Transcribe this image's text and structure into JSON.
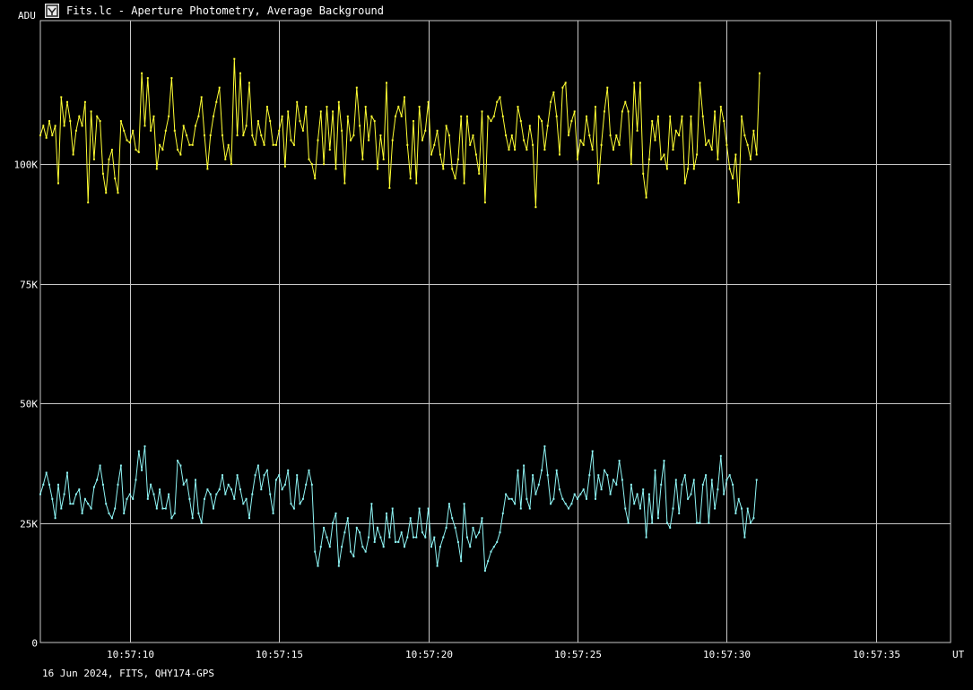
{
  "window": {
    "title": "Fits.lc - Aperture Photometry, Average Background",
    "icon": "app-icon"
  },
  "footer": "16 Jun 2024, FITS, QHY174-GPS",
  "colors": {
    "background": "#000000",
    "grid": "#c8c8c8",
    "series_photometry": "#ffff33",
    "series_background": "#8ff5f5"
  },
  "chart_data": {
    "type": "line",
    "ylabel": "ADU",
    "xlabel": "UT",
    "ylim": [
      0,
      130000
    ],
    "xlim": [
      7.0,
      37.5
    ],
    "x_unit": "seconds after 10:57:00 UT",
    "y_ticks": [
      {
        "value": 0,
        "label": "0"
      },
      {
        "value": 25000,
        "label": "25K"
      },
      {
        "value": 50000,
        "label": "50K"
      },
      {
        "value": 75000,
        "label": "75K"
      },
      {
        "value": 100000,
        "label": "100K"
      }
    ],
    "x_ticks": [
      {
        "value": 10,
        "label": "10:57:10"
      },
      {
        "value": 15,
        "label": "10:57:15"
      },
      {
        "value": 20,
        "label": "10:57:20"
      },
      {
        "value": 25,
        "label": "10:57:25"
      },
      {
        "value": 30,
        "label": "10:57:30"
      },
      {
        "value": 35,
        "label": "10:57:35"
      }
    ],
    "grid": true,
    "x": {
      "start": 7.0,
      "step": 0.1
    },
    "series": [
      {
        "values": [
          106000,
          108000,
          105500,
          109000,
          106000,
          108000,
          96000,
          114000,
          108000,
          113000,
          109000,
          102000,
          107000,
          110000,
          108000,
          113000,
          92000,
          111000,
          101000,
          110000,
          109000,
          98000,
          94000,
          101000,
          103000,
          97000,
          94000,
          109000,
          107000,
          105000,
          104500,
          107000,
          103000,
          102500,
          119000,
          108000,
          118000,
          107000,
          110000,
          99000,
          104000,
          103000,
          107000,
          110000,
          118000,
          107000,
          103000,
          102000,
          108000,
          106000,
          104000,
          104000,
          108000,
          110000,
          114000,
          106000,
          99000,
          106000,
          110000,
          113000,
          116000,
          106000,
          101000,
          104000,
          100000,
          122000,
          106000,
          119000,
          106000,
          108000,
          117000,
          106000,
          104000,
          109000,
          106000,
          104000,
          112000,
          109000,
          104000,
          104000,
          107000,
          110000,
          99500,
          111000,
          105000,
          104000,
          113000,
          109000,
          107000,
          112000,
          101000,
          100000,
          97000,
          105000,
          111000,
          100000,
          112000,
          103000,
          111000,
          99000,
          113000,
          107000,
          96000,
          110000,
          105000,
          106000,
          116000,
          108000,
          101000,
          112000,
          105000,
          110000,
          109000,
          99000,
          106000,
          101000,
          117000,
          95000,
          105000,
          110000,
          112000,
          110000,
          114000,
          104000,
          97000,
          109000,
          96000,
          112000,
          105000,
          107000,
          113000,
          102000,
          104000,
          107000,
          102000,
          99000,
          108000,
          106000,
          99000,
          97000,
          101000,
          110000,
          96000,
          110000,
          104000,
          106000,
          102000,
          98000,
          111000,
          92000,
          110000,
          109000,
          110000,
          113000,
          114000,
          110000,
          106000,
          103000,
          106000,
          103000,
          112000,
          109000,
          105000,
          103000,
          108000,
          104000,
          91000,
          110000,
          109000,
          103000,
          108000,
          113000,
          115000,
          110000,
          102000,
          116000,
          117000,
          106000,
          109000,
          111000,
          101000,
          105000,
          104000,
          110000,
          106000,
          103000,
          112000,
          96000,
          104000,
          111000,
          116000,
          106000,
          103000,
          106000,
          104000,
          111000,
          113000,
          111000,
          100000,
          117000,
          107000,
          117000,
          98000,
          93000,
          101000,
          109000,
          105000,
          110000,
          101000,
          102000,
          99000,
          110000,
          103000,
          107000,
          106000,
          110000,
          96000,
          99000,
          110000,
          99000,
          102000,
          117000,
          110000,
          104000,
          105000,
          103000,
          111000,
          101000,
          112000,
          109000,
          104000,
          99000,
          97000,
          102000,
          92000,
          110000,
          106000,
          104000,
          101000,
          107000,
          102000,
          119000
        ]
      },
      {
        "values": [
          31000,
          33000,
          35500,
          33000,
          30000,
          26000,
          33000,
          28000,
          31000,
          35500,
          29000,
          29000,
          31000,
          32000,
          27000,
          30000,
          29000,
          28000,
          32500,
          34000,
          37000,
          33000,
          29000,
          27000,
          26000,
          28000,
          33000,
          37000,
          27000,
          30000,
          31000,
          30000,
          34000,
          40000,
          36000,
          41000,
          30000,
          33000,
          31000,
          28000,
          32000,
          28000,
          28000,
          31000,
          26000,
          27000,
          38000,
          37000,
          33000,
          34000,
          30000,
          26000,
          34000,
          27000,
          25000,
          30000,
          32000,
          31000,
          28000,
          31000,
          32000,
          35000,
          31000,
          33000,
          32000,
          30000,
          35000,
          32000,
          29000,
          30000,
          26000,
          31000,
          35000,
          37000,
          32000,
          35000,
          36000,
          31000,
          27000,
          34000,
          35000,
          32000,
          33000,
          36000,
          29000,
          28000,
          35000,
          29000,
          30000,
          33000,
          36000,
          33000,
          19000,
          16000,
          20000,
          24000,
          22000,
          20000,
          25000,
          27000,
          16000,
          20000,
          23000,
          26000,
          19000,
          18000,
          24000,
          23000,
          20000,
          19000,
          22000,
          29000,
          21000,
          24000,
          22000,
          20000,
          27000,
          22000,
          28000,
          21000,
          21000,
          23000,
          20000,
          22000,
          26000,
          22000,
          22000,
          28000,
          23000,
          22000,
          28000,
          20000,
          22000,
          16000,
          20000,
          22000,
          24000,
          29000,
          26000,
          24000,
          21000,
          17000,
          29000,
          22000,
          20000,
          24000,
          22000,
          23000,
          26000,
          15000,
          17000,
          19000,
          20000,
          21000,
          23000,
          27000,
          31000,
          30000,
          30000,
          29000,
          36000,
          28000,
          37000,
          30000,
          28000,
          35000,
          31000,
          33000,
          36000,
          41000,
          35000,
          29000,
          30000,
          36000,
          32000,
          30000,
          29000,
          28000,
          29000,
          31000,
          30000,
          31000,
          32000,
          30000,
          35000,
          40000,
          30000,
          35000,
          32000,
          36000,
          35000,
          31000,
          34000,
          33000,
          38000,
          34000,
          28000,
          25000,
          33000,
          29000,
          31000,
          28000,
          32000,
          22000,
          31000,
          25000,
          36000,
          26000,
          33000,
          38000,
          25000,
          24000,
          28000,
          34000,
          27000,
          33000,
          35000,
          30000,
          31000,
          34000,
          25000,
          25000,
          33000,
          35000,
          25000,
          34000,
          28000,
          32000,
          39000,
          31000,
          34000,
          35000,
          33000,
          27000,
          30000,
          28000,
          22000,
          28000,
          25000,
          26000,
          34000
        ]
      }
    ]
  }
}
